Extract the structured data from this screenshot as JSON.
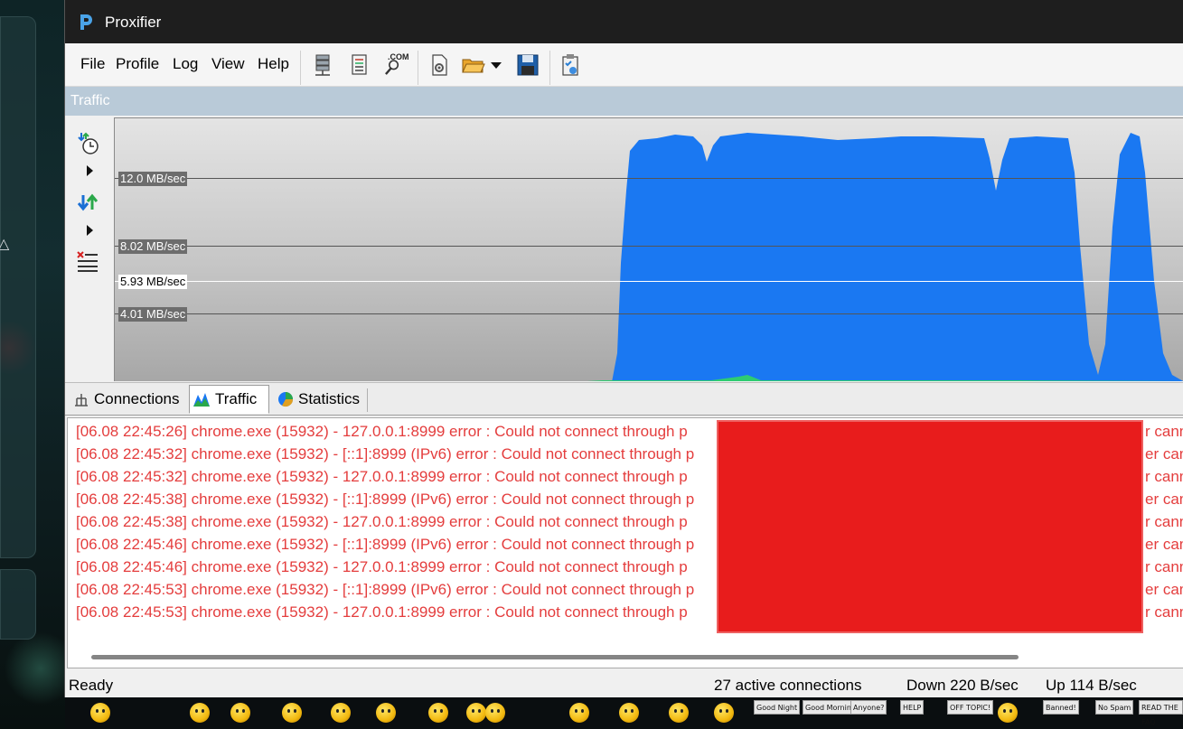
{
  "window": {
    "title": "Proxifier"
  },
  "menu": [
    "File",
    "Profile",
    "Log",
    "View",
    "Help"
  ],
  "toolbar": {
    "dns_badge": ".COM"
  },
  "panel": {
    "title": "Traffic"
  },
  "graph": {
    "levels": [
      "12.0 MB/sec",
      "8.02 MB/sec",
      "5.93 MB/sec",
      "4.01 MB/sec"
    ],
    "fill_color": "#1a78f2",
    "upload_color": "#2ecc71"
  },
  "tabs": [
    {
      "label": "Connections",
      "active": false
    },
    {
      "label": "Traffic",
      "active": true
    },
    {
      "label": "Statistics",
      "active": false
    }
  ],
  "log": {
    "color": "#e43d3d",
    "lines": [
      "[06.08 22:45:26] chrome.exe (15932) - 127.0.0.1:8999 error : Could not connect through p",
      "[06.08 22:45:32] chrome.exe (15932) - [::1]:8999 (IPv6) error : Could not connect through p",
      "[06.08 22:45:32] chrome.exe (15932) - 127.0.0.1:8999 error : Could not connect through p",
      "[06.08 22:45:38] chrome.exe (15932) - [::1]:8999 (IPv6) error : Could not connect through p",
      "[06.08 22:45:38] chrome.exe (15932) - 127.0.0.1:8999 error : Could not connect through p",
      "[06.08 22:45:46] chrome.exe (15932) - [::1]:8999 (IPv6) error : Could not connect through p",
      "[06.08 22:45:46] chrome.exe (15932) - 127.0.0.1:8999 error : Could not connect through p",
      "[06.08 22:45:53] chrome.exe (15932) - [::1]:8999 (IPv6) error : Could not connect through p",
      "[06.08 22:45:53] chrome.exe (15932) - 127.0.0.1:8999 error : Could not connect through p"
    ],
    "tails": [
      "r cann",
      "er can",
      "r cann",
      "er can",
      "r cann",
      "er can",
      "r cann",
      "er can",
      "r cann"
    ]
  },
  "status": {
    "state": "Ready",
    "connections": "27 active connections",
    "down": "Down 220 B/sec",
    "up": "Up 114 B/sec"
  },
  "taskbar_signs": [
    "Good Night",
    "Good Morning",
    "Anyone?",
    "HELP",
    "OFF TOPIC!",
    "Banned!",
    "No Spam",
    "READ THE FAQ"
  ]
}
